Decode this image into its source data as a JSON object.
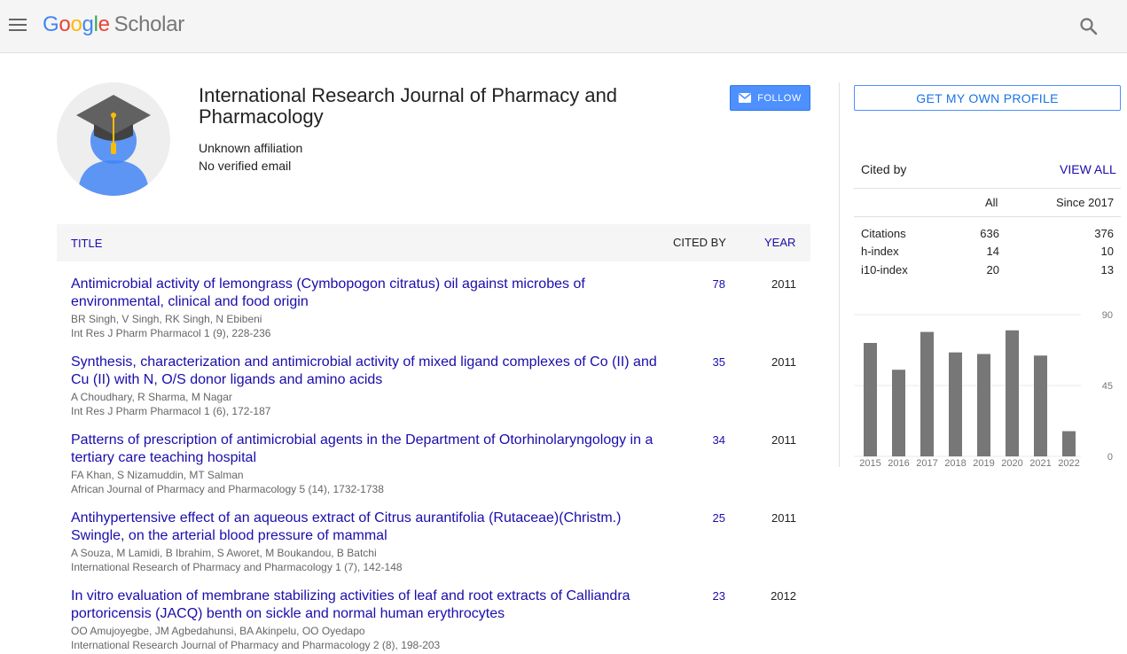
{
  "header": {
    "logo_letters": [
      "G",
      "o",
      "o",
      "g",
      "l",
      "e"
    ],
    "logo_suffix": "Scholar"
  },
  "profile": {
    "name": "International Research Journal of Pharmacy and Pharmacology",
    "affiliation": "Unknown affiliation",
    "email": "No verified email",
    "follow_label": "FOLLOW"
  },
  "table": {
    "col_title": "TITLE",
    "col_cited": "CITED BY",
    "col_year": "YEAR",
    "rows": [
      {
        "title": "Antimicrobial activity of lemongrass (Cymbopogon citratus) oil against microbes of environmental, clinical and food origin",
        "authors": "BR Singh, V Singh, RK Singh, N Ebibeni",
        "venue": "Int Res J Pharm Pharmacol 1 (9), 228-236",
        "cited": "78",
        "year": "2011"
      },
      {
        "title": "Synthesis, characterization and antimicrobial activity of mixed ligand complexes of Co (II) and Cu (II) with N, O/S donor ligands and amino acids",
        "authors": "A Choudhary, R Sharma, M Nagar",
        "venue": "Int Res J Pharm Pharmacol 1 (6), 172-187",
        "cited": "35",
        "year": "2011"
      },
      {
        "title": "Patterns of prescription of antimicrobial agents in the Department of Otorhinolaryngology in a tertiary care teaching hospital",
        "authors": "FA Khan, S Nizamuddin, MT Salman",
        "venue": "African Journal of Pharmacy and Pharmacology 5 (14), 1732-1738",
        "cited": "34",
        "year": "2011"
      },
      {
        "title": "Antihypertensive effect of an aqueous extract of Citrus aurantifolia (Rutaceae)(Christm.) Swingle, on the arterial blood pressure of mammal",
        "authors": "A Souza, M Lamidi, B Ibrahim, S Aworet, M Boukandou, B Batchi",
        "venue": "International Research of Pharmacy and Pharmacology 1 (7), 142-148",
        "cited": "25",
        "year": "2011"
      },
      {
        "title": "In vitro evaluation of membrane stabilizing activities of leaf and root extracts of Calliandra portoricensis (JACQ) benth on sickle and normal human erythrocytes",
        "authors": "OO Amujoyegbe, JM Agbedahunsi, BA Akinpelu, OO Oyedapo",
        "venue": "International Research Journal of Pharmacy and Pharmacology 2 (8), 198-203",
        "cited": "23",
        "year": "2012"
      }
    ]
  },
  "sidebar": {
    "get_profile_label": "GET MY OWN PROFILE",
    "cited_by_label": "Cited by",
    "view_all_label": "VIEW ALL",
    "stats_header_all": "All",
    "stats_header_since": "Since 2017",
    "stats": [
      {
        "label": "Citations",
        "all": "636",
        "since": "376"
      },
      {
        "label": "h-index",
        "all": "14",
        "since": "10"
      },
      {
        "label": "i10-index",
        "all": "20",
        "since": "13"
      }
    ]
  },
  "chart_data": {
    "type": "bar",
    "categories": [
      "2015",
      "2016",
      "2017",
      "2018",
      "2019",
      "2020",
      "2021",
      "2022"
    ],
    "values": [
      72,
      55,
      79,
      66,
      65,
      80,
      64,
      16
    ],
    "ylim": [
      0,
      90
    ],
    "yticks": [
      "90",
      "45",
      "0"
    ],
    "grid": true,
    "bar_color": "#777777"
  },
  "colors": {
    "link": "#1a0dab",
    "accent": "#4d90fe"
  }
}
